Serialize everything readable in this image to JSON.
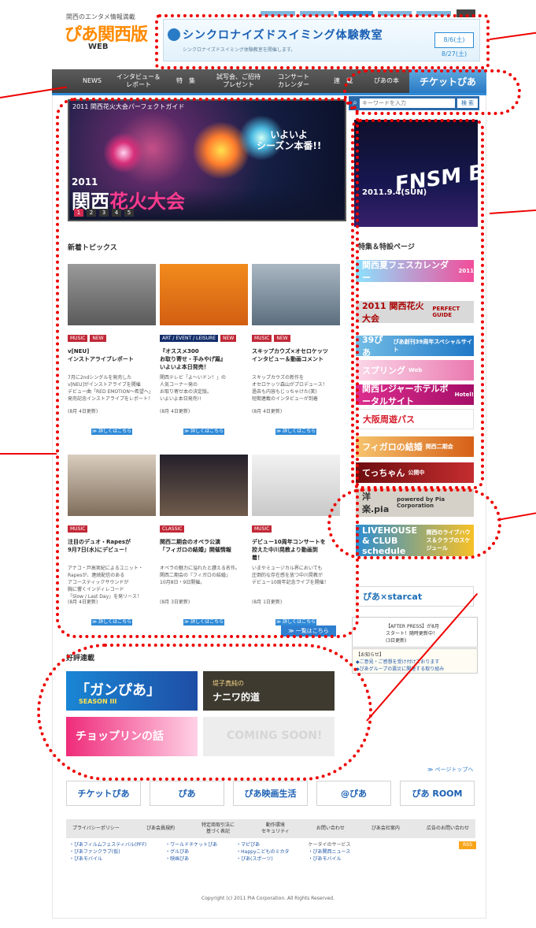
{
  "header": {
    "logo_subtitle": "関西のエンタメ情報満載",
    "logo_main": "ぴあ関西版",
    "logo_accent": "関西版",
    "logo_web": "WEB",
    "banner_title": "シンクロナイズドスイミング体験教室",
    "banner_subtitle": "シンクロナイズドスイミング体験教室を開催します。",
    "banner_date": "8/6(土) 8/27(土)"
  },
  "nav": {
    "items": [
      {
        "label": "NEWS"
      },
      {
        "label": "インタビュー＆\nレポート"
      },
      {
        "label": "特　集"
      },
      {
        "label": "試写会、ご招待\nプレゼント"
      },
      {
        "label": "コンサート\nカレンダー"
      },
      {
        "label": "連　載"
      },
      {
        "label": "ぴあの本"
      }
    ],
    "ticket_label": "チケットぴあ"
  },
  "search": {
    "placeholder": "キーワードを入力",
    "button_label": "検 索"
  },
  "hero": {
    "caption": "2011 関西花火大会パーフェクトガイド",
    "tag_line1": "いよいよ",
    "tag_line2": "シーズン本番!!",
    "title_year": "2011",
    "title_main": "関西",
    "title_accent": "花火大会",
    "dots": [
      "1",
      "2",
      "3",
      "4",
      "5"
    ]
  },
  "topics": {
    "title": "新着トピックス",
    "items": [
      {
        "tags": [
          "MUSIC",
          "NEW"
        ],
        "title": "v[NEU]\nインストアライブレポート",
        "desc": "7月に2ndシングルを発売した\nv[NEU]がインストアライブを開催\nデビュー曲「RED EMOTION～希望へ」\n発売記念インストアライブをレポート！",
        "date": "(8月 4日更新)",
        "more": "≫ 詳しくはこちら"
      },
      {
        "tags": [
          "ART / EVENT / LEISURE",
          "NEW"
        ],
        "title": "『オススメ300\nお取り寄せ・手みやげ篇』\nいよいよ本日発売！",
        "desc": "関西テレビ「よ～いドン！」の\n人気コーナー発の\nお取り寄せ本の決定版。\nいよいよ本日発売!!",
        "date": "(8月 4日更新)",
        "more": "≫ 詳しくはこちら"
      },
      {
        "tags": [
          "MUSIC",
          "NEW"
        ],
        "title": "スキップカウズ×オセロケッツ\nインタビュー＆動画コメント",
        "desc": "スキップカウズの新作を\nオセロケッツ森山がプロデュース！\n過去も内容もじっちゃけた(笑)\n短期連載のインタビューが到着",
        "date": "(8月 4日更新)",
        "more": "≫ 詳しくはこちら"
      },
      {
        "tags": [
          "MUSIC"
        ],
        "title": "注目のデュオ・Rapesが\n9月7日(水)にデビュー！",
        "desc": "アナコ・戸高実紀によるユニット・\nRapesが、連続配信のある\nアコースティックサウンドが\n胸に響くインディレコード\n「Slow / Last Day」を発リース！",
        "date": "(8月 4日更新)",
        "more": "≫ 詳しくはこちら"
      },
      {
        "tags": [
          "CLASSIC"
        ],
        "title": "関西二期会のオペラ公演\n「フィガロの結婚」開催情報",
        "desc": "オペラの魅力に溢れたと讃える名作。\n関西二期会の『フィガロの結婚』\n10月8日・9日開催。",
        "date": "(8月 3日更新)",
        "more": "≫ 詳しくはこちら"
      },
      {
        "tags": [
          "MUSIC"
        ],
        "title": "デビュー10周年コンサートを\n控えた中川晃教より動画到\n着！",
        "desc": "いまやミュージカル界においても\n圧倒的な存在感を放つ中川晃教が\nデビュー10周年記念ライブを開催！",
        "date": "(8月 1日更新)",
        "more": "≫ 詳しくはこちら"
      }
    ],
    "more_label": "≫ 一覧はこちら"
  },
  "right": {
    "fes_text": "FNSM BALL",
    "fes_date": "2011.9.4(SUN)",
    "section_title": "特集＆特設ページ",
    "banners": [
      {
        "label": "関西夏フェスカレンダー",
        "sub": "2011"
      },
      {
        "label": "2011 関西花火大会",
        "sub": "PERFECT GUIDE"
      },
      {
        "label": "39ぴあ",
        "sub": "ぴあ創刊39周年スペシャルサイト"
      },
      {
        "label": "スプリング",
        "sub": "Web"
      },
      {
        "label": "関西レジャーホテルポータルサイト",
        "sub": "Hotel!"
      },
      {
        "label": "大阪周遊パス",
        "sub": ""
      },
      {
        "label": "フィガロの結婚",
        "sub": "関西二期会"
      },
      {
        "label": "てっちゃん",
        "sub": "公開中"
      },
      {
        "label": "洋楽.pia",
        "sub": "powered by Pia Corporation"
      },
      {
        "label": "LIVEHOUSE & CLUB schedule",
        "sub": "関西のライブハウス＆クラブのスケジュール"
      },
      {
        "label": "ぴあ×starcat",
        "sub": ""
      }
    ],
    "notice1_title": "【AFTER PRESS】が8月",
    "notice1_body": "スタート！随時更新中！",
    "notice1_date": "(3日更新)",
    "notice2_title": "【お知らせ】",
    "notice2_line1": "◆ご意見・ご感想を受け付けております",
    "notice2_line2": "◆ぴあグループの震災に関連する取り組み"
  },
  "series": {
    "title": "好評連載",
    "items": [
      {
        "label": "「ガンぴあ」",
        "sub": "SEASON III"
      },
      {
        "label": "堤子真純の",
        "sub": "ナニワ的道"
      },
      {
        "label": "チョップリンの話",
        "sub": ""
      },
      {
        "label": "COMING SOON!",
        "sub": ""
      }
    ],
    "pagetop": "≫ ページトップへ"
  },
  "footer": {
    "logos": [
      "チケットぴあ",
      "ぴあ",
      "ぴあ映画生活",
      "@ぴあ",
      "ぴあ ROOM"
    ],
    "nav": [
      "プライバシーポリシー",
      "ぴあ会員規約",
      "特定商取引法に\n基づく表記",
      "動作環境\nセキュリティ",
      "お問い合わせ",
      "ぴあ会社案内",
      "広告のお問い合わせ"
    ],
    "col1": [
      "・ぴあフィルムフェスティバル(PFF)",
      "・ぴあファンクラブ(仮)",
      "・ぴあモバイル"
    ],
    "col2": [
      "・ワールドチケットぴあ",
      "・グルぴあ",
      "・映画ぴあ"
    ],
    "col3": [
      "・マピぴあ",
      "・Happyこどものミカタ",
      "・ぴあ(スポーツ)"
    ],
    "col4": [
      "ケータイのサービス",
      "・ぴあ関西ニュース",
      "・ぴあモバイル"
    ],
    "rss": "RSS",
    "copyright": "Copyright (c) 2011 PIA Corporation. All Rights Reserved."
  }
}
